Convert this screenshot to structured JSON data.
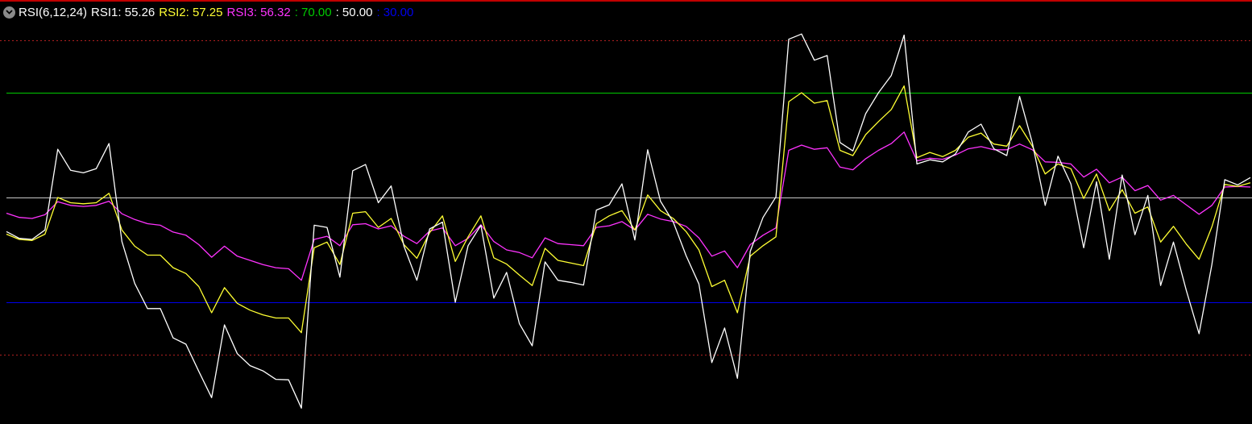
{
  "header": {
    "indicator": "RSI(6,12,24)",
    "rsi1_label": "RSI1: 55.26",
    "rsi2_label": "RSI2: 57.25",
    "rsi3_label": "RSI3: 56.32",
    "level_high": ": 70.00",
    "level_mid": ": 50.00",
    "level_low": ": 30.00"
  },
  "colors": {
    "background": "#000000",
    "rsi1": "#ffffff",
    "rsi2": "#ffff33",
    "rsi3": "#ff33ff",
    "level_high": "#00cc00",
    "level_mid": "#c8c8c8",
    "level_low": "#0000ee",
    "dotted_bound": "#b02020",
    "indicator_text": "#ffffff"
  },
  "chart_data": {
    "type": "line",
    "ylim": [
      11,
      88
    ],
    "reference_lines": [
      {
        "value": 80,
        "style": "dotted",
        "color": "#b02020"
      },
      {
        "value": 70,
        "style": "solid",
        "color": "#00cc00"
      },
      {
        "value": 50,
        "style": "solid",
        "color": "#c8c8c8"
      },
      {
        "value": 30,
        "style": "solid",
        "color": "#0000ee"
      },
      {
        "value": 20,
        "style": "dotted",
        "color": "#b02020"
      }
    ],
    "series": [
      {
        "name": "RSI1",
        "color": "#ffffff",
        "values": [
          43.5,
          42.2,
          42,
          43.8,
          59.2,
          55.2,
          54.7,
          55.5,
          60.3,
          41.6,
          33.6,
          28.8,
          28.8,
          23.2,
          22,
          16.8,
          11.8,
          25.7,
          20.2,
          17.9,
          16.9,
          15.3,
          15.2,
          9.8,
          44.7,
          44.3,
          34.8,
          55.1,
          56.3,
          49,
          52.2,
          40.7,
          34.2,
          44,
          45.3,
          30,
          40.8,
          44.7,
          30.8,
          35.7,
          25.9,
          21.7,
          37.7,
          34.2,
          33.8,
          33.3,
          47.6,
          48.6,
          52.6,
          41.9,
          59.1,
          49.3,
          45.3,
          38.9,
          33.5,
          18.5,
          25.1,
          15.5,
          39.7,
          46.2,
          50.1,
          80.2,
          81.2,
          76.2,
          77.1,
          60.5,
          58.9,
          66,
          70,
          73.3,
          81,
          56.4,
          57.2,
          56.8,
          58.3,
          62.5,
          64,
          59.3,
          58,
          69.3,
          60.4,
          48.5,
          57.9,
          52.6,
          40.4,
          53,
          38.2,
          54.3,
          42.9,
          50.4,
          33.2,
          41.5,
          32.3,
          24,
          37.2,
          53.4,
          52.4,
          53.8
        ]
      },
      {
        "name": "RSI2",
        "color": "#ffff33",
        "values": [
          43,
          42,
          41.8,
          43,
          50,
          49,
          48.8,
          49,
          50.8,
          43.8,
          40.7,
          39,
          39,
          36.6,
          35.5,
          33,
          28,
          32.8,
          29.8,
          28.5,
          27.6,
          27,
          27,
          24.2,
          40.4,
          41.5,
          37.2,
          47,
          47.3,
          44.3,
          46,
          41,
          38.4,
          43.3,
          46.5,
          37.8,
          42.5,
          46.5,
          38.5,
          37.3,
          35.2,
          33.2,
          40.3,
          38,
          37.5,
          37,
          45,
          46.5,
          47.5,
          43.8,
          50.5,
          47.5,
          46,
          43.5,
          40,
          33,
          34.2,
          28,
          38.8,
          40.8,
          42.5,
          68.3,
          70,
          68,
          68.5,
          59,
          58,
          62,
          64.5,
          66.8,
          71.3,
          57.6,
          58.6,
          57.8,
          59,
          61.5,
          62.3,
          60.2,
          59.8,
          63.7,
          59.8,
          54.5,
          56.4,
          55.5,
          49.8,
          54.5,
          47.5,
          51.5,
          47,
          48.2,
          41.5,
          44.5,
          41.1,
          38.2,
          44.4,
          52.5,
          52.1,
          52.8
        ]
      },
      {
        "name": "RSI3",
        "color": "#ff33ff",
        "values": [
          47,
          46.2,
          46,
          46.7,
          49.2,
          48.5,
          48.3,
          48.5,
          49.3,
          46.9,
          45.8,
          45,
          44.7,
          43.4,
          42.8,
          41,
          38.6,
          40.7,
          38.8,
          38,
          37.2,
          36.6,
          36.4,
          34.2,
          42,
          42.6,
          40.8,
          44.8,
          45,
          44,
          44.6,
          42.6,
          41.2,
          43.6,
          44.2,
          40.8,
          42.2,
          44.8,
          41.6,
          40,
          39.5,
          38.5,
          42.3,
          41.2,
          41,
          40.8,
          44.3,
          44.6,
          45.4,
          43.8,
          46.8,
          45.9,
          45.4,
          44.5,
          42.3,
          38.8,
          39.8,
          36.6,
          41,
          42.8,
          44.2,
          59,
          60,
          59.2,
          59.5,
          55.8,
          55.3,
          57.4,
          59,
          60.3,
          62.5,
          57,
          57.5,
          57.3,
          58.1,
          59.3,
          59.7,
          59.1,
          59.1,
          60.2,
          59.1,
          56.8,
          56.7,
          56.4,
          53.9,
          55.4,
          52.8,
          53.9,
          51.3,
          52.3,
          49.5,
          50.4,
          48.6,
          46.8,
          48.5,
          52,
          52.1,
          52
        ]
      }
    ]
  }
}
